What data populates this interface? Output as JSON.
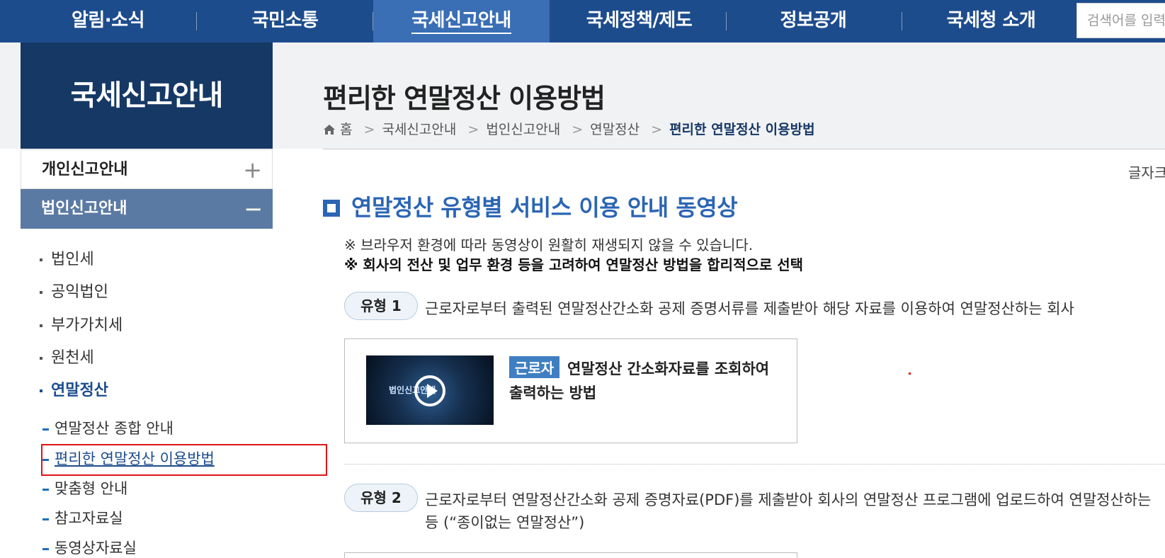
{
  "topnav": {
    "items": [
      "알림·소식",
      "국민소통",
      "국세신고안내",
      "국세정책/제도",
      "정보공개",
      "국세청 소개"
    ],
    "active_index": 2,
    "search_placeholder": "검색어를 입력"
  },
  "sidebar": {
    "title": "국세신고안내",
    "personal": {
      "label": "개인신고안내",
      "toggle": "+"
    },
    "corporate": {
      "label": "법인신고안내",
      "toggle": "−"
    },
    "subitems": [
      "법인세",
      "공익법인",
      "부가가치세",
      "원천세",
      "연말정산"
    ],
    "current_subitem": "연말정산",
    "year_end_items": [
      "연말정산 종합 안내",
      "편리한 연말정산 이용방법",
      "맞춤형 안내",
      "참고자료실",
      "동영상자료실"
    ],
    "current_year_end_item": "편리한 연말정산 이용방법"
  },
  "header": {
    "title": "편리한 연말정산 이용방법",
    "breadcrumb": [
      "홈",
      "국세신고안내",
      "법인신고안내",
      "연말정산",
      "편리한 연말정산 이용방법"
    ],
    "font_size_label": "글자크"
  },
  "content": {
    "section_title": "연말정산 유형별 서비스 이용 안내 동영상",
    "note1": "※ 브라우저 환경에 따라 동영상이 원활히 재생되지 않을 수 있습니다.",
    "note2": "※ 회사의 전산 및 업무 환경 등을 고려하여 연말정산 방법을 합리적으로 선택",
    "types": [
      {
        "label": "유형 1",
        "desc": "근로자로부터 출력된 연말정산간소화 공제 증명서류를 제출받아 해당 자료를 이용하여 연말정산하는 회사"
      },
      {
        "label": "유형 2",
        "desc": "근로자로부터 연말정산간소화 공제 증명자료(PDF)를 제출받아 회사의 연말정산 프로그램에 업로드하여 연말정산하는",
        "desc2": "등 (“종이없는 연말정산”)"
      }
    ],
    "video_card": {
      "badge": "근로자",
      "title_line1": "연말정산 간소화자료를 조회하여",
      "title_line2": "출력하는 방법",
      "thumb_text": "법인신고안내"
    }
  },
  "colors": {
    "nav": "#1d4c8d",
    "nav_active": "#3a6eb5",
    "sidebar_title": "#163865",
    "sidebar_active": "#5b7aa3",
    "accent": "#2b65b4",
    "highlight": "#e01515"
  }
}
